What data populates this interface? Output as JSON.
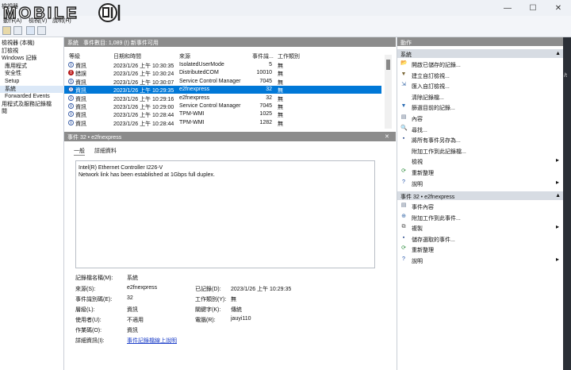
{
  "window": {
    "title": "檢視器",
    "menu": [
      "動作(A)",
      "檢視(V)",
      "說明(H)"
    ],
    "controls": [
      "—",
      "☐",
      "✕"
    ]
  },
  "logo": {
    "text": "MOBILE"
  },
  "tree": {
    "items": [
      {
        "label": "檢視器 (本機)",
        "indent": 0
      },
      {
        "label": "訂檢視",
        "indent": 0
      },
      {
        "label": "Windows 記錄",
        "indent": 0
      },
      {
        "label": "應用程式",
        "indent": 2
      },
      {
        "label": "安全性",
        "indent": 2
      },
      {
        "label": "Setup",
        "indent": 2
      },
      {
        "label": "系統",
        "indent": 2,
        "selected": true
      },
      {
        "label": "Forwarded Events",
        "indent": 2
      },
      {
        "label": "用程式及服務記錄檔",
        "indent": 0
      },
      {
        "label": "閱",
        "indent": 0
      }
    ]
  },
  "list": {
    "header_title": "系統",
    "header_count": "事件數目: 1,089 (!) 新事件可用",
    "columns": [
      "等級",
      "日期和時間",
      "來源",
      "事件識...",
      "工作類別"
    ],
    "rows": [
      {
        "level_icon": "info-icon",
        "level": "資訊",
        "datetime": "2023/1/26 上午 10:30:35",
        "source": "IsolatedUserMode",
        "id": "5",
        "task": "無"
      },
      {
        "level_icon": "error-icon",
        "level": "錯誤",
        "datetime": "2023/1/26 上午 10:30:24",
        "source": "DistributedCOM",
        "id": "10010",
        "task": "無"
      },
      {
        "level_icon": "info-icon",
        "level": "資訊",
        "datetime": "2023/1/26 上午 10:30:07",
        "source": "Service Control Manager",
        "id": "7045",
        "task": "無"
      },
      {
        "level_icon": "info-icon",
        "level": "資訊",
        "datetime": "2023/1/26 上午 10:29:35",
        "source": "e2fnexpress",
        "id": "32",
        "task": "無",
        "selected": true
      },
      {
        "level_icon": "info-icon",
        "level": "資訊",
        "datetime": "2023/1/26 上午 10:29:16",
        "source": "e2fnexpress",
        "id": "32",
        "task": "無"
      },
      {
        "level_icon": "info-icon",
        "level": "資訊",
        "datetime": "2023/1/26 上午 10:29:00",
        "source": "Service Control Manager",
        "id": "7045",
        "task": "無"
      },
      {
        "level_icon": "info-icon",
        "level": "資訊",
        "datetime": "2023/1/26 上午 10:28:44",
        "source": "TPM-WMI",
        "id": "1025",
        "task": "無"
      },
      {
        "level_icon": "info-icon",
        "level": "資訊",
        "datetime": "2023/1/26 上午 10:28:44",
        "source": "TPM-WMI",
        "id": "1282",
        "task": "無"
      }
    ]
  },
  "detail": {
    "title": "事件 32 • e2fnexpress",
    "close": "✕",
    "tabs": [
      "一般",
      "詳細資料"
    ],
    "description_line1": "Intel(R) Ethernet Controller I226-V",
    "description_line2": "Network link has been established at 1Gbps full duplex.",
    "fields": {
      "log_name_label": "記錄檔名稱(M):",
      "log_name": "系統",
      "source_label": "來源(S):",
      "source": "e2fnexpress",
      "logged_label": "已記錄(D):",
      "logged": "2023/1/26 上午 10:29:35",
      "event_id_label": "事件識別碼(E):",
      "event_id": "32",
      "task_label": "工作類別(Y):",
      "task": "無",
      "level_label": "層級(L):",
      "level": "資訊",
      "keywords_label": "關鍵字(K):",
      "keywords": "傳統",
      "user_label": "使用者(U):",
      "user": "不適用",
      "computer_label": "電腦(R):",
      "computer": "jauyi110",
      "opcode_label": "作業碼(O):",
      "opcode": "資訊",
      "more_info_label": "詳細資訊(I):",
      "more_info_link": "事件記錄檔線上說明"
    }
  },
  "actions": {
    "title": "動作",
    "section1": "系統",
    "section1_items": [
      {
        "icon": "folder-open-icon",
        "label": "開啟已儲存的記錄..."
      },
      {
        "icon": "filter-create-icon",
        "label": "建立自訂檢視..."
      },
      {
        "icon": "import-icon",
        "label": "匯入自訂檢視..."
      },
      {
        "icon": "",
        "label": "清除記錄檔..."
      },
      {
        "icon": "filter-icon",
        "label": "篩選目前的記錄..."
      },
      {
        "icon": "properties-icon",
        "label": "內容"
      },
      {
        "icon": "find-icon",
        "label": "尋找..."
      },
      {
        "icon": "save-icon",
        "label": "將所有事件另存為..."
      },
      {
        "icon": "",
        "label": "附加工作到此記錄檔..."
      },
      {
        "icon": "",
        "label": "檢視",
        "submenu": true
      },
      {
        "icon": "refresh-icon",
        "label": "重新整理"
      },
      {
        "icon": "help-icon",
        "label": "說明",
        "submenu": true
      }
    ],
    "section2": "事件 32 • e2fnexpress",
    "section2_items": [
      {
        "icon": "event-properties-icon",
        "label": "事件內容"
      },
      {
        "icon": "task-icon",
        "label": "附加工作到此事件..."
      },
      {
        "icon": "copy-icon",
        "label": "複製",
        "submenu": true
      },
      {
        "icon": "save-icon",
        "label": "儲存選取的事件..."
      },
      {
        "icon": "refresh-icon",
        "label": "重新整理"
      },
      {
        "icon": "help-icon",
        "label": "說明",
        "submenu": true
      }
    ]
  },
  "edge": {
    "glyph": "/t"
  }
}
